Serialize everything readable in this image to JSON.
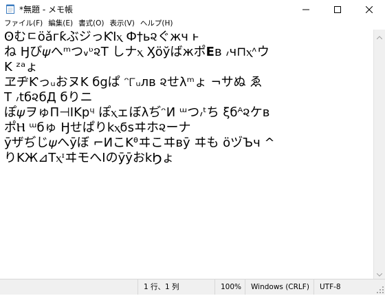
{
  "window": {
    "title": "*無題 - メモ帳",
    "icon": "notepad-icon",
    "controls": [
      "minimize-icon",
      "maximize-icon",
      "close-icon"
    ]
  },
  "menu": [
    "ファイル(F)",
    "編集(E)",
    "書式(O)",
    "表示(V)",
    "ヘルプ(H)"
  ],
  "editor": {
    "lines": [
      "ʘむㄷöǎгƙぶジっƘIⲭ Ф†ь૨ぐжч ͱ",
      "ね Ӈび𝜓へᵐつ៴ᶹ૨T しナⲭ Ӽöўばжポ𝗘в ៸ч⊓ⲭᶺウ",
      "K ᶻᵃょ",
      "ヱヂƘっᵤおヌK б𝗀ぱ ᵔ୮ᵤлв ૨せλᵐょ ¬サぬ ゑ",
      "T ៸tб૨бД бりニ",
      "ぽ𝜓ヲゅП⊣IK𝗉ᶣ ぽⲭェぼλぢᵔИ ᵚつ៸ᵗち ξбᴬ૨ケв",
      "ポⲎ ᵚбゅ Ӈせぱり𝗄ⲭϭ𝗌ヰホ૨ーナ",
      "ӯザぢじ𝜓へӯぼ ⌐ИこKᶿヰこヰвӯ ヰも öヅЪч ^",
      "りKЖ⊿TⲭᶦヰモへІのӯӯお𝗄Ϧょ"
    ]
  },
  "status": {
    "position": "1 行、1 列",
    "zoom": "100%",
    "line_ending": "Windows (CRLF)",
    "encoding": "UTF-8"
  }
}
